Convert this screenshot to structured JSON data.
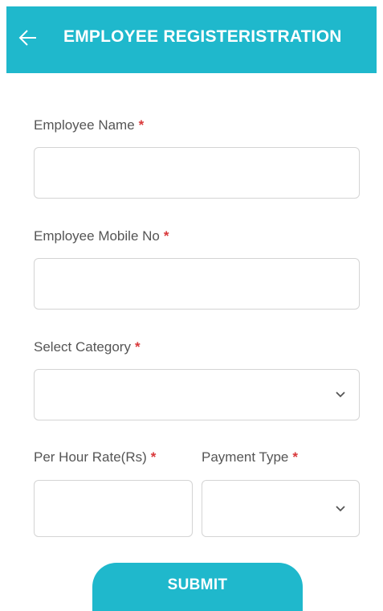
{
  "header": {
    "title": "EMPLOYEE REGISTERISTRATION",
    "back_icon": "arrow-left-icon",
    "background_color": "#1fb8cc"
  },
  "form": {
    "required_marker": "*",
    "employee_name": {
      "label": "Employee Name",
      "value": ""
    },
    "employee_mobile": {
      "label": "Employee Mobile No",
      "value": ""
    },
    "category": {
      "label": "Select Category",
      "selected": ""
    },
    "hour_rate": {
      "label": "Per Hour Rate(Rs)",
      "value": ""
    },
    "payment_type": {
      "label": "Payment Type",
      "selected": ""
    }
  },
  "submit": {
    "label": "SUBMIT",
    "color": "#1fb8cc"
  },
  "colors": {
    "required": "#d9383a",
    "label_text": "#555555",
    "input_border": "#d4d4d4"
  }
}
